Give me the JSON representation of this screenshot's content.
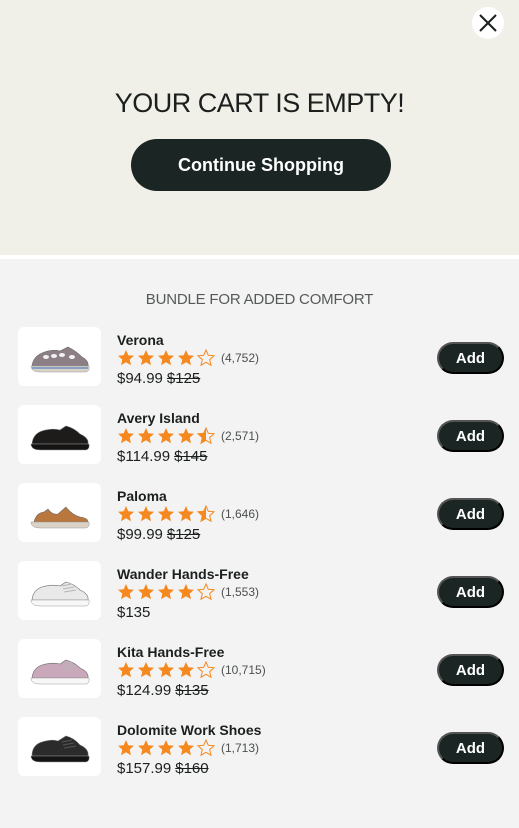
{
  "cart": {
    "empty_title": "YOUR CART IS EMPTY!",
    "continue_label": "Continue Shopping",
    "close_icon": "close-icon"
  },
  "bundle": {
    "heading": "BUNDLE FOR ADDED COMFORT",
    "add_label": "Add",
    "star_color": "#f5891f",
    "items": [
      {
        "name": "Verona",
        "rating": 4,
        "reviews": "(4,752)",
        "price": "$94.99",
        "was": "$125",
        "shoe_color": "#8c7f86",
        "shoe_style": "sandal-closed"
      },
      {
        "name": "Avery Island",
        "rating": 4.5,
        "reviews": "(2,571)",
        "price": "$114.99",
        "was": "$145",
        "shoe_color": "#1e1c1b",
        "shoe_style": "oxford"
      },
      {
        "name": "Paloma",
        "rating": 4.5,
        "reviews": "(1,646)",
        "price": "$99.99",
        "was": "$125",
        "shoe_color": "#b9773e",
        "shoe_style": "sandal-open"
      },
      {
        "name": "Wander Hands-Free",
        "rating": 4,
        "reviews": "(1,553)",
        "price": "$135",
        "was": "",
        "shoe_color": "#e9e9e9",
        "shoe_style": "sneaker"
      },
      {
        "name": "Kita Hands-Free",
        "rating": 4,
        "reviews": "(10,715)",
        "price": "$124.99",
        "was": "$135",
        "shoe_color": "#c9a8bb",
        "shoe_style": "sneaker"
      },
      {
        "name": "Dolomite Work Shoes",
        "rating": 4,
        "reviews": "(1,713)",
        "price": "$157.99",
        "was": "$160",
        "shoe_color": "#2b2b2b",
        "shoe_style": "work"
      }
    ]
  }
}
